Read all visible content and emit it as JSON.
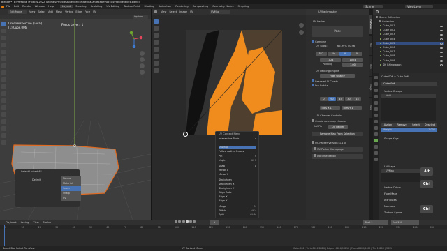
{
  "window_title": "Blender* [E:\\Personal Projects\\2022 Tutorials\\Pinecrest\\Blender\\4K\\NeridaLandscape\\Rock04\\Handleflex04.blend]",
  "top_menu": [
    "File",
    "Edit",
    "Render",
    "Window",
    "Help"
  ],
  "workspace_tabs": [
    "Layout",
    "Modeling",
    "Sculpting",
    "UV Editing",
    "Texture Paint",
    "Shading",
    "Animation",
    "Rendering",
    "Compositing",
    "Geometry Nodes",
    "Scripting"
  ],
  "scene_fields": {
    "scene": "Scene",
    "view_layer": "ViewLayer"
  },
  "viewport": {
    "mode": "Edit Mode",
    "view_items": [
      "View",
      "Select",
      "Add",
      "Mesh",
      "Vertex",
      "Edge",
      "Face",
      "UV"
    ],
    "info_line1": "User Perspective (Local)",
    "info_line2": "(1) Cube.006",
    "focus_label": "Focus Level:- 1",
    "options": "Options",
    "transform": "Global"
  },
  "uv_editor": {
    "header_items": [
      "View",
      "Select",
      "Image",
      "UV"
    ],
    "uv_toggle": "UV",
    "image_name": "UVMap"
  },
  "select_linked_popup": {
    "title": "Select Linked All",
    "delimit_label": "Delimit",
    "options": [
      "Normal",
      "Material",
      "Seam",
      "Sharp",
      "UV"
    ],
    "selected": "Seam"
  },
  "context_menu": {
    "title": "UV Context Menu",
    "items": [
      {
        "label": "Interactive Tools",
        "sc": "▸"
      },
      {
        "label": "Unwrap",
        "sc": ""
      },
      {
        "label": "Follow Active Quads",
        "sc": ""
      },
      {
        "label": "Pin",
        "sc": "P"
      },
      {
        "label": "Unpin",
        "sc": "Alt P"
      },
      {
        "label": "Snap",
        "sc": "▸"
      },
      {
        "label": "Mirror X",
        "sc": ""
      },
      {
        "label": "Mirror Y",
        "sc": ""
      },
      {
        "label": "Straighten",
        "sc": ""
      },
      {
        "label": "Straighten X",
        "sc": ""
      },
      {
        "label": "Straighten Y",
        "sc": ""
      },
      {
        "label": "Align Auto",
        "sc": ""
      },
      {
        "label": "Align X",
        "sc": ""
      },
      {
        "label": "Align Y",
        "sc": ""
      },
      {
        "label": "Merge",
        "sc": "M"
      },
      {
        "label": "Stitch",
        "sc": "Alt V"
      },
      {
        "label": "Split",
        "sc": "Alt M"
      }
    ],
    "highlighted": "Unwrap"
  },
  "uv_packer": {
    "panel_title": "UVPackmaster",
    "section": "UV-Packer",
    "pack_button": "Pack",
    "combine_label": "Combine",
    "uv_stats_label": "UV Stats:",
    "uv_stats_value": "66.99% | 0.96",
    "size_values": [
      "512",
      "1k",
      "2k",
      "4k"
    ],
    "res_values": [
      "1024",
      "1024"
    ],
    "padding_label": "Padding",
    "padding_value": "1.00",
    "packing_engine_label": "UV Packing Engine",
    "engine_value": "High Quality",
    "rescale_label": "Rescale UV Charts",
    "prerotate_label": "Pre-Rotate",
    "rotations": [
      "0",
      "90",
      "45",
      "30",
      "15"
    ],
    "tiles_x_label": "Tiles X",
    "tiles_x_value": "1",
    "tiles_y_label": "Tiles Y",
    "tiles_y_value": "1",
    "channel_controls_label": "UV Channel Controls",
    "create_channel_label": "Create new map channel",
    "uv_fix_label": "UV Fix",
    "uv_fix_value": "UV Packer",
    "remove_button": "Remove Map From Selection",
    "version_label": "UV-Packer Version: 1.1.0",
    "homepage_button": "UV-Packer Homepage",
    "doc_button": "Documentation",
    "side_tabs": [
      "UV-Packer",
      "Tool",
      "Item",
      "Image",
      "View"
    ]
  },
  "outliner": {
    "title": "Scene Collection",
    "collection": "Collection",
    "items": [
      {
        "name": "Cube_001"
      },
      {
        "name": "Cube_002"
      },
      {
        "name": "Cube_003"
      },
      {
        "name": "Cube_004"
      },
      {
        "name": "Cube_005"
      },
      {
        "name": "Cube_006"
      },
      {
        "name": "Cube_007"
      },
      {
        "name": "Cube_008"
      },
      {
        "name": "Cube_009"
      },
      {
        "name": "SK_Rhinoragon"
      }
    ],
    "selected_index": 4
  },
  "properties": {
    "object_path": "Cube.006  >  Cube.006",
    "mesh_name": "Cube.006",
    "vertex_groups_label": "Vertex Groups",
    "vg_item": "Hold",
    "assign_buttons": [
      "Assign",
      "Remove",
      "Select",
      "Deselect"
    ],
    "weight_label": "Weight",
    "weight_value": "1.000",
    "shape_keys_label": "Shape Keys",
    "uv_maps_label": "UV Maps",
    "uv_map_item": "UVMap",
    "sections": [
      "Vertex Colors",
      "Face Maps",
      "Attributes",
      "Normals",
      "Texture Space"
    ]
  },
  "key_overlays": [
    "Alt",
    "Ctrl",
    "Ctrl",
    "Alt"
  ],
  "timeline": {
    "items": [
      "Playback",
      "Keying",
      "View",
      "Marker"
    ],
    "start_label": "Start",
    "start_value": "1",
    "end_label": "End",
    "end_value": "250",
    "current_frame": "1",
    "ticks": [
      "0",
      "10",
      "20",
      "30",
      "40",
      "50",
      "60",
      "70",
      "80",
      "90",
      "100",
      "110",
      "120",
      "130",
      "140",
      "150",
      "160",
      "170",
      "180",
      "190",
      "200",
      "210",
      "220",
      "230",
      "240",
      "250"
    ]
  },
  "status_bar": {
    "left": "Select   Box Select   Pan View",
    "right": "UV Context Menu",
    "stats": "Cube.006 | Verts 8416/8416 | Edges 16816/16816 | Faces 8400/8400 | Tris 16800 | 3.2.1"
  },
  "colors": {
    "accent": "#4772b3",
    "orange": "#f08c1e",
    "selection": "#e06a20"
  }
}
